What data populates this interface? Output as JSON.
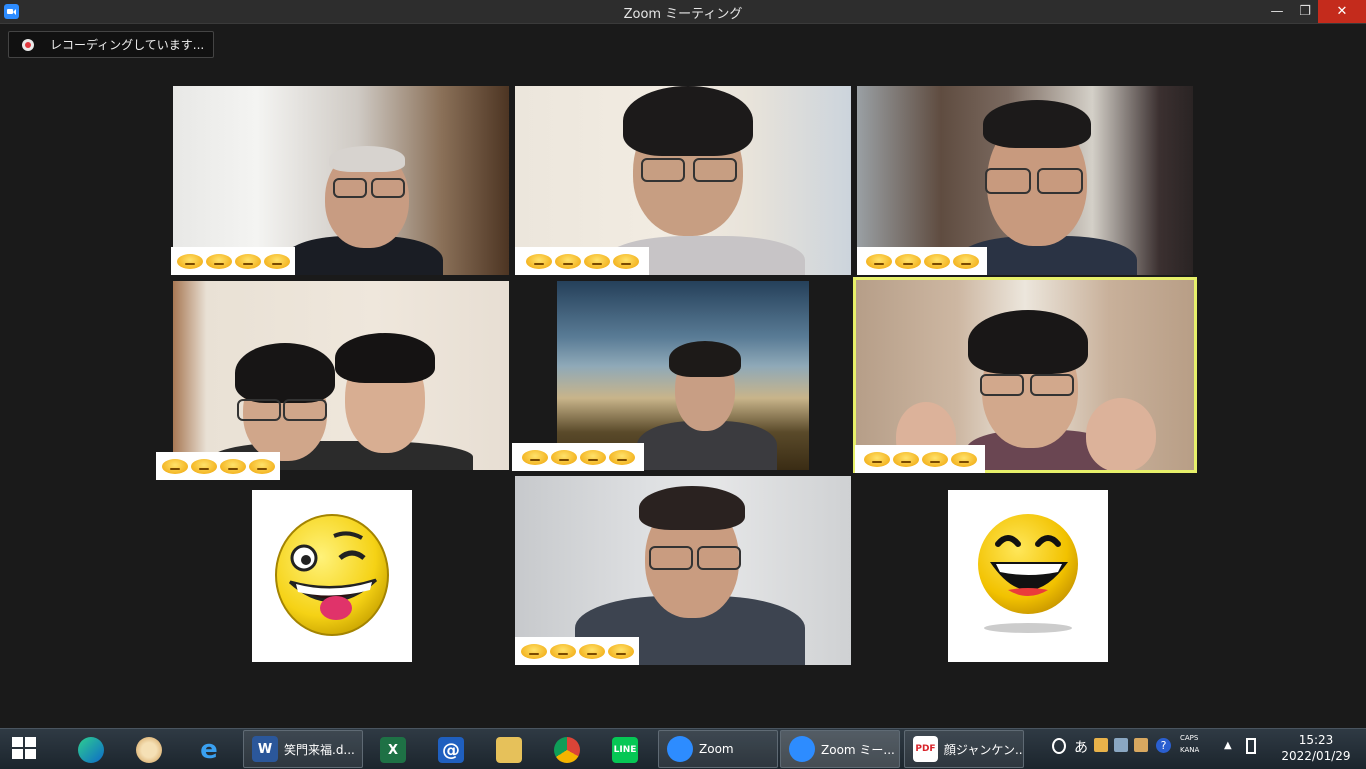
{
  "window": {
    "title": "Zoom ミーティング",
    "minimize": "—",
    "maximize": "❐",
    "close": "✕"
  },
  "recording": {
    "label": "レコーディングしています..."
  },
  "taskbar": {
    "apps": [
      {
        "name": "edge-icon"
      },
      {
        "name": "paint-icon"
      },
      {
        "name": "internet-explorer-icon"
      },
      {
        "name": "word-document",
        "label": "笑門来福.d..."
      },
      {
        "name": "excel-icon"
      },
      {
        "name": "mail-icon"
      },
      {
        "name": "file-explorer-icon"
      },
      {
        "name": "chrome-icon"
      },
      {
        "name": "line-icon",
        "label": "LINE"
      },
      {
        "name": "zoom-app",
        "label": "Zoom"
      },
      {
        "name": "zoom-meeting",
        "label": "Zoom ミー..."
      },
      {
        "name": "pdf-document",
        "label": "顔ジャンケン..."
      }
    ],
    "tray": {
      "ime": "あ",
      "caps": "CAPS",
      "kana": "KANA"
    },
    "clock": {
      "time": "15:23",
      "date": "2022/01/29"
    }
  },
  "colors": {
    "active_speaker_border": "#e7f06a",
    "zoom_blue": "#2d8cff",
    "close_red": "#c42b1c"
  }
}
